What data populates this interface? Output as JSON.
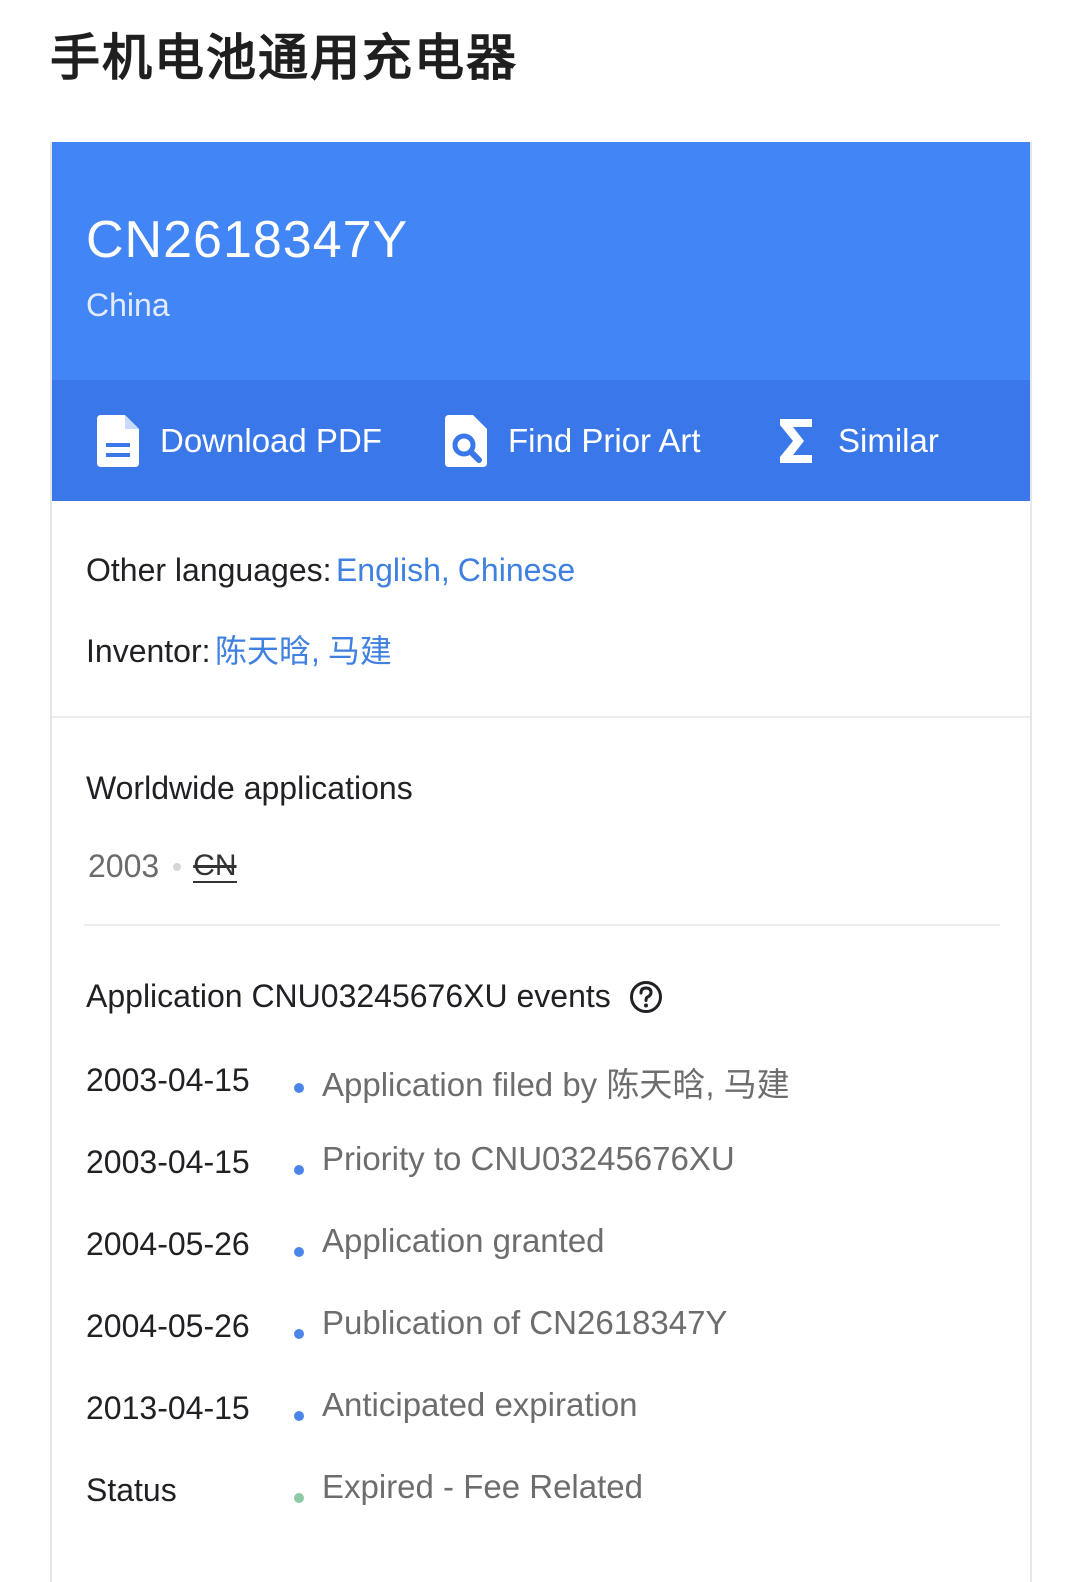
{
  "page": {
    "title": "手机电池通用充电器"
  },
  "header": {
    "publication_number": "CN2618347Y",
    "country": "China"
  },
  "toolbar": {
    "download_label": "Download PDF",
    "prior_art_label": "Find Prior Art",
    "similar_label": "Similar"
  },
  "meta": {
    "languages_key": "Other languages:",
    "languages": [
      "English",
      "Chinese"
    ],
    "inventor_key": "Inventor:",
    "inventors": [
      "陈天晗",
      "马建"
    ]
  },
  "worldwide": {
    "title": "Worldwide applications",
    "year": "2003",
    "country_code": "CN"
  },
  "events": {
    "title": "Application CNU03245676XU events",
    "items": [
      {
        "date": "2003-04-15",
        "description": "Application filed by 陈天晗, 马建"
      },
      {
        "date": "2003-04-15",
        "description": "Priority to CNU03245676XU"
      },
      {
        "date": "2004-05-26",
        "description": "Application granted"
      },
      {
        "date": "2004-05-26",
        "description": "Publication of CN2618347Y"
      },
      {
        "date": "2013-04-15",
        "description": "Anticipated expiration"
      },
      {
        "date": "Status",
        "description": "Expired - Fee Related"
      }
    ]
  },
  "colors": {
    "hero": "#4285f4",
    "toolbar": "#3a77e8",
    "link": "#3f80e0",
    "event_bullet": "#4a86e8",
    "status_bullet": "#8cc9a4"
  }
}
